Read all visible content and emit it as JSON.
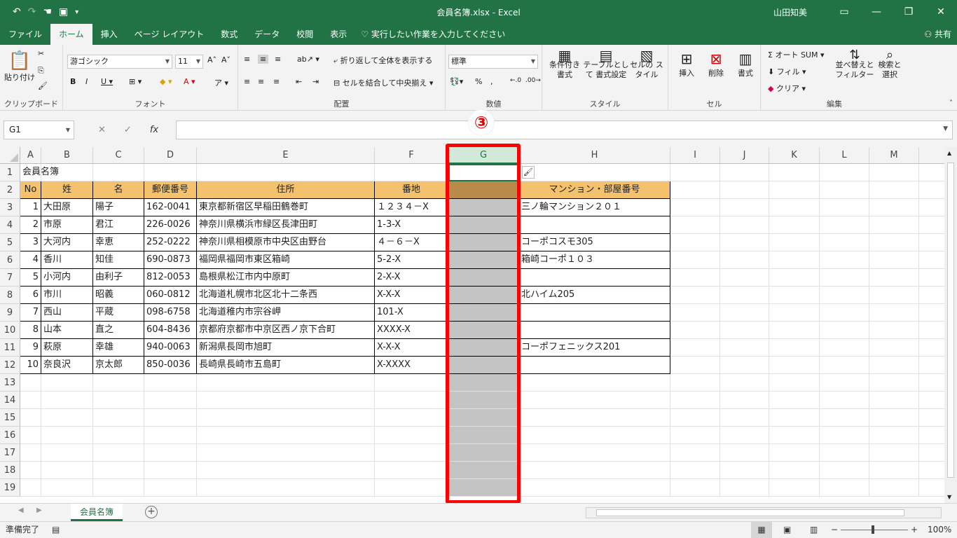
{
  "title": {
    "document": "会員名簿.xlsx  -  Excel",
    "user": "山田知美"
  },
  "tabs": [
    "ファイル",
    "ホーム",
    "挿入",
    "ページ レイアウト",
    "数式",
    "データ",
    "校閲",
    "表示"
  ],
  "tellme": "実行したい作業を入力してください",
  "share": "共有",
  "ribbon": {
    "paste": "貼り付け",
    "clipboard": "クリップボード",
    "font_name": "游ゴシック",
    "font_size": "11",
    "font_group": "フォント",
    "wrap": "折り返して全体を表示する",
    "merge": "セルを結合して中央揃え",
    "align_group": "配置",
    "number_format": "標準",
    "number_group": "数値",
    "cond_format": "条件付き 書式",
    "table_format": "テーブルとして 書式設定",
    "cell_style": "セルの スタイル",
    "style_group": "スタイル",
    "insert": "挿入",
    "delete": "削除",
    "format": "書式",
    "cells_group": "セル",
    "autosum": "オート SUM",
    "fill": "フィル",
    "clear": "クリア",
    "sort": "並べ替えと フィルター",
    "find": "検索と 選択",
    "edit_group": "編集"
  },
  "formula": {
    "namebox": "G1",
    "fx": "fx"
  },
  "callout": "③",
  "columns": [
    "A",
    "B",
    "C",
    "D",
    "E",
    "F",
    "G",
    "H",
    "I",
    "J",
    "K",
    "L",
    "M"
  ],
  "rows": [
    "1",
    "2",
    "3",
    "4",
    "5",
    "6",
    "7",
    "8",
    "9",
    "10",
    "11",
    "12",
    "13",
    "14",
    "15",
    "16",
    "17",
    "18",
    "19"
  ],
  "a1": "会員名簿",
  "headers": [
    "No",
    "姓",
    "名",
    "郵便番号",
    "住所",
    "番地",
    "",
    "マンション・部屋番号"
  ],
  "records": [
    [
      "1",
      "大田原",
      "陽子",
      "162-0041",
      "東京都新宿区早稲田鶴巻町",
      "１２３４－X",
      "",
      "三ノ輪マンション２０１"
    ],
    [
      "2",
      "市原",
      "君江",
      "226-0026",
      "神奈川県横浜市緑区長津田町",
      "1-3-X",
      "",
      ""
    ],
    [
      "3",
      "大河内",
      "幸恵",
      "252-0222",
      "神奈川県相模原市中央区由野台",
      "４－６－X",
      "",
      "コーポコスモ305"
    ],
    [
      "4",
      "香川",
      "知佳",
      "690-0873",
      "福岡県福岡市東区箱崎",
      "5-2-X",
      "",
      "箱崎コーポ１０３"
    ],
    [
      "5",
      "小河内",
      "由利子",
      "812-0053",
      "島根県松江市内中原町",
      "2-X-X",
      "",
      ""
    ],
    [
      "6",
      "市川",
      "昭義",
      "060-0812",
      "北海道札幌市北区北十二条西",
      "X-X-X",
      "",
      "北ハイム205"
    ],
    [
      "7",
      "西山",
      "平蔵",
      "098-6758",
      "北海道稚内市宗谷岬",
      "101-X",
      "",
      ""
    ],
    [
      "8",
      "山本",
      "直之",
      "604-8436",
      "京都府京都市中京区西ノ京下合町",
      "XXXX-X",
      "",
      ""
    ],
    [
      "9",
      "萩原",
      "幸雄",
      "940-0063",
      "新潟県長岡市旭町",
      "X-X-X",
      "",
      "コーポフェニックス201"
    ],
    [
      "10",
      "奈良沢",
      "京太郎",
      "850-0036",
      "長崎県長崎市五島町",
      "X-XXXX",
      "",
      ""
    ]
  ],
  "sheet": "会員名簿",
  "status": {
    "ready": "準備完了",
    "zoom": "100%"
  }
}
